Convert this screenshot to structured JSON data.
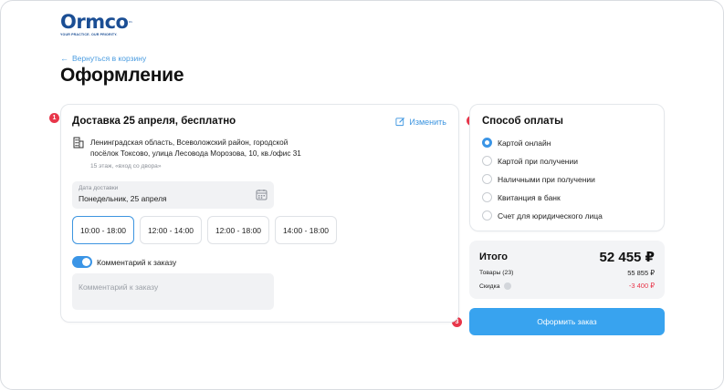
{
  "brand": {
    "name": "Ormco",
    "trademark": "™",
    "tagline": "YOUR PRACTICE. OUR PRIORITY."
  },
  "nav": {
    "back_label": "Вернуться в корзину"
  },
  "page": {
    "title": "Оформление"
  },
  "steps": {
    "delivery": "1",
    "payment": "2",
    "order": "3"
  },
  "delivery": {
    "title": "Доставка 25 апреля, бесплатно",
    "edit_label": "Изменить",
    "address_line1": "Ленинградская область, Всеволожский район, городской",
    "address_line2": "посёлок Токсово, улица Лесовода Морозова, 10, кв./офис 31",
    "address_note": "15 этаж, «вход со двора»",
    "date_label": "Дата доставки",
    "date_value": "Понедельник, 25 апреля",
    "time_slots": [
      "10:00 - 18:00",
      "12:00 - 14:00",
      "12:00 - 18:00",
      "14:00 - 18:00"
    ],
    "selected_slot": "10:00 - 18:00",
    "comment_toggle_label": "Комментарий к заказу",
    "comment_toggle_on": true,
    "comment_placeholder": "Комментарий к заказу"
  },
  "payment": {
    "title": "Способ оплаты",
    "options": [
      "Картой онлайн",
      "Картой при получении",
      "Наличными при получении",
      "Квитанция в банк",
      "Счет для юридического лица"
    ],
    "selected": "Картой онлайн"
  },
  "summary": {
    "title": "Итого",
    "total": "52 455 ₽",
    "items_label": "Товары (23)",
    "items_value": "55 855 ₽",
    "discount_label": "Скидка",
    "discount_value": "-3 400 ₽"
  },
  "order_button": "Оформить заказ",
  "colors": {
    "accent": "#38a3ef",
    "brand": "#1b4e94",
    "badge": "#e8364a",
    "discount": "#e8364a"
  }
}
